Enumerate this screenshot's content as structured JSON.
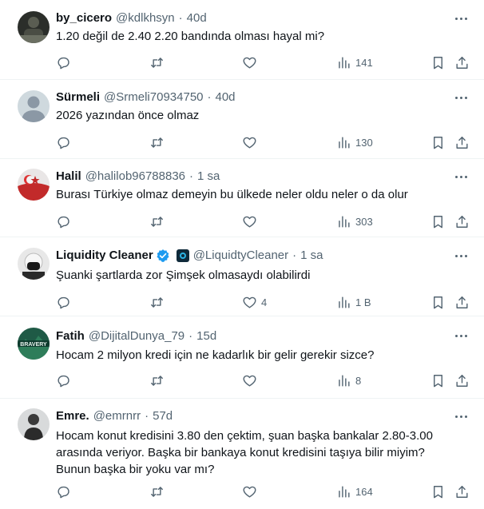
{
  "colors": {
    "text": "#0f1419",
    "secondary": "#536471",
    "verified": "#1d9bf0",
    "border": "#eff3f4"
  },
  "icons": {
    "reply": "speech-bubble-outline",
    "retweet": "retweet-arrows",
    "like": "heart-outline",
    "views": "bar-chart",
    "bookmark": "bookmark-outline",
    "share": "upload-arrow",
    "more": "three-dots-horizontal"
  },
  "tweets": [
    {
      "name": "by_cicero",
      "handle": "@kdlkhsyn",
      "separator": "·",
      "time": "40d",
      "text": "1.20 değil de 2.40 2.20 bandında olması hayal mi?",
      "likes": "",
      "views": "141"
    },
    {
      "name": "Sürmeli",
      "handle": "@Srmeli70934750",
      "separator": "·",
      "time": "40d",
      "text": "2026 yazından önce olmaz",
      "likes": "",
      "views": "130"
    },
    {
      "name": "Halil",
      "handle": "@halilob96788836",
      "separator": "·",
      "time": "1 sa",
      "text": "Burası Türkiye olmaz demeyin bu ülkede neler oldu neler o da olur",
      "likes": "",
      "views": "303"
    },
    {
      "name": "Liquidity Cleaner",
      "handle": "@LiquidtyCleaner",
      "separator": "·",
      "time": "1 sa",
      "text": "Şuanki şartlarda zor Şimşek olmasaydı olabilirdi",
      "likes": "4",
      "views": "1 B"
    },
    {
      "name": "Fatih",
      "handle": "@DijitalDunya_79",
      "separator": "·",
      "time": "15d",
      "text": "Hocam 2 milyon kredi için ne kadarlık bir gelir gerekir sizce?",
      "likes": "",
      "views": "8"
    },
    {
      "name": "Emre.",
      "handle": "@emrnrr",
      "separator": "·",
      "time": "57d",
      "text_lines": [
        "Hocam konut kredisini 3.80 den çektim, şuan başka bankalar 2.80-3.00",
        "arasında veriyor. Başka bir bankaya konut kredisini taşıya bilir miyim?",
        "Bunun başka bir yoku var mı?"
      ],
      "likes": "",
      "views": "164"
    }
  ]
}
